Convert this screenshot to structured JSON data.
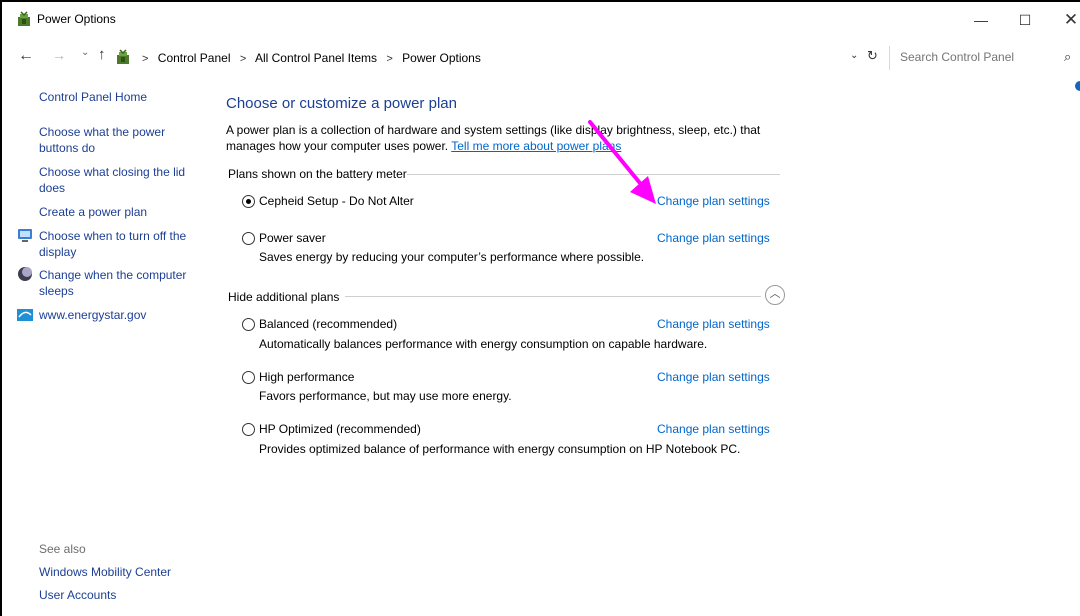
{
  "window": {
    "title": "Power Options",
    "controls": {
      "minimize": "—",
      "maximize": "☐",
      "close": "✕"
    }
  },
  "address_bar": {
    "breadcrumb": [
      "Control Panel",
      "All Control Panel Items",
      "Power Options"
    ],
    "search_placeholder": "Search Control Panel"
  },
  "left_pane": {
    "home": "Control Panel Home",
    "items": [
      {
        "label": "Choose what the power buttons do",
        "icon": ""
      },
      {
        "label": "Choose what closing the lid does",
        "icon": ""
      },
      {
        "label": "Create a power plan",
        "icon": ""
      },
      {
        "label": "Choose when to turn off the display",
        "icon": "monitor-icon"
      },
      {
        "label": "Change when the computer sleeps",
        "icon": "moon-icon"
      },
      {
        "label": "www.energystar.gov",
        "icon": "energystar-icon"
      }
    ],
    "see_also": {
      "label": "See also",
      "links": [
        "Windows Mobility Center",
        "User Accounts"
      ]
    }
  },
  "main": {
    "title": "Choose or customize a power plan",
    "description": "A power plan is a collection of hardware and system settings (like display brightness, sleep, etc.) that manages how your computer uses power.",
    "learn_more_link": "Tell me more about power plans",
    "battery_group_label": "Plans shown on the battery meter",
    "additional_group_label": "Hide additional plans",
    "change_link_label": "Change plan settings",
    "plans": [
      {
        "name": "Cepheid Setup - Do Not Alter",
        "description": "",
        "selected": true
      },
      {
        "name": "Power saver",
        "description": "Saves energy by reducing your computer’s performance where possible.",
        "selected": false
      },
      {
        "name": "Balanced (recommended)",
        "description": "Automatically balances performance with energy consumption on capable hardware.",
        "selected": false
      },
      {
        "name": "High performance",
        "description": "Favors performance, but may use more energy.",
        "selected": false
      },
      {
        "name": "HP Optimized (recommended)",
        "description": "Provides optimized balance of performance with energy consumption on HP Notebook PC.",
        "selected": false
      }
    ]
  },
  "colors": {
    "link": "#0066cc",
    "heading": "#1c3f94",
    "annotation_arrow": "#ff00ff"
  }
}
